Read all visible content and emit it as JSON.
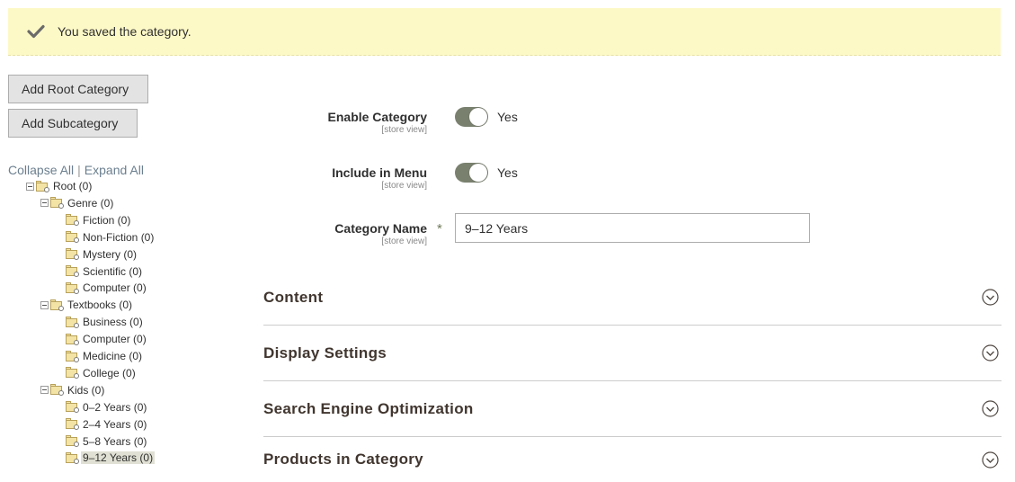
{
  "message": {
    "text": "You saved the category."
  },
  "buttons": {
    "add_root": "Add Root Category",
    "add_sub": "Add Subcategory"
  },
  "tree_links": {
    "collapse": "Collapse All",
    "separator": "|",
    "expand": "Expand All"
  },
  "tree": [
    {
      "label": "Root (0)",
      "selected": false
    },
    {
      "label": "Genre (0)",
      "selected": false
    },
    {
      "label": "Fiction (0)",
      "selected": false
    },
    {
      "label": "Non-Fiction (0)",
      "selected": false
    },
    {
      "label": "Mystery (0)",
      "selected": false
    },
    {
      "label": "Scientific (0)",
      "selected": false
    },
    {
      "label": "Computer (0)",
      "selected": false
    },
    {
      "label": "Textbooks (0)",
      "selected": false
    },
    {
      "label": "Business (0)",
      "selected": false
    },
    {
      "label": "Computer (0)",
      "selected": false
    },
    {
      "label": "Medicine (0)",
      "selected": false
    },
    {
      "label": "College (0)",
      "selected": false
    },
    {
      "label": "Kids (0)",
      "selected": false
    },
    {
      "label": "0–2 Years (0)",
      "selected": false
    },
    {
      "label": "2–4 Years (0)",
      "selected": false
    },
    {
      "label": "5–8 Years (0)",
      "selected": false
    },
    {
      "label": "9–12 Years (0)",
      "selected": true
    }
  ],
  "form": {
    "enable": {
      "label": "Enable Category",
      "scope": "[store view]",
      "value": "Yes",
      "on": true
    },
    "menu": {
      "label": "Include in Menu",
      "scope": "[store view]",
      "value": "Yes",
      "on": true
    },
    "name": {
      "label": "Category Name",
      "scope": "[store view]",
      "required": "*",
      "value": "9–12 Years"
    }
  },
  "sections": [
    {
      "title": "Content"
    },
    {
      "title": "Display Settings"
    },
    {
      "title": "Search Engine Optimization"
    },
    {
      "title": "Products in Category"
    }
  ],
  "colors": {
    "message_bg": "#fdf9c7",
    "toggle_on": "#79806e",
    "link": "#6b7f8f",
    "selected_bg": "#e0e0d4"
  }
}
